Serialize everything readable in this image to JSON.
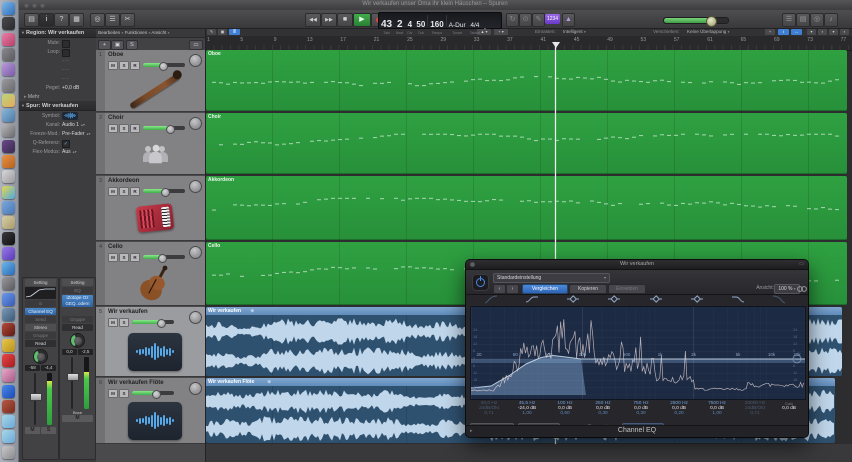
{
  "window": {
    "title": "Wir verkaufen unser Oma ihr klein Häuschen – Spuren"
  },
  "icons": {
    "library": "▤",
    "inspector": "i",
    "quick_help": "?",
    "toolbar_toggle": "▦",
    "smart_controls": "◎",
    "mixer": "☰",
    "editors": "✂",
    "rewind": "◀◀",
    "forward": "▶▶",
    "stop": "■",
    "play": "▶",
    "cycle": "↻",
    "autopunch": "⊙",
    "replace": "✎",
    "metronome": "▲",
    "list_editor": "☰",
    "note_pad": "▤",
    "loop_browser": "◎",
    "media_browser": "♪",
    "pencil_tool": "✎",
    "catch": "▣",
    "midi_in": "≣",
    "pointer_tool": "▲",
    "plus_tool": "+",
    "crosshair": "+",
    "ibeam": "I",
    "hscroll": "↔"
  },
  "transport": {
    "bar": "43",
    "beat": "2",
    "division": "4",
    "tick": "50",
    "tempo": "160",
    "key": "A-Dur",
    "timesig": "4/4",
    "labels": {
      "bar": "Takt",
      "beat": "Beat",
      "division": "Div",
      "tick": "Tick",
      "tempo": "Tempo",
      "key": "Tonart",
      "timesig": "Taktart"
    },
    "countin_badge": "1234"
  },
  "snap": {
    "einrasten_label": "Einrasten:",
    "einrasten_value": "Intelligent",
    "verschieben_label": "Verschieben:",
    "verschieben_value": "Keine Überlappung"
  },
  "menus": {
    "bearbeiten": "Bearbeiten",
    "funktionen": "Funktionen",
    "ansicht": "Ansicht"
  },
  "inspector": {
    "region_header": "Region: Wir verkaufen",
    "track_header": "Spur: Wir verkaufen",
    "region_rows": [
      {
        "label": "Mute:",
        "type": "check",
        "value": ""
      },
      {
        "label": "Loop:",
        "type": "check",
        "value": ""
      },
      {
        "label": "",
        "type": "dash",
        "value": "– –"
      },
      {
        "label": "",
        "type": "dash",
        "value": "– –"
      },
      {
        "label": "",
        "type": "dash",
        "value": "– –"
      },
      {
        "label": "Pegel:",
        "type": "text",
        "value": "+0,0 dB"
      },
      {
        "label": "",
        "type": "disclosure",
        "value": "Mehr"
      }
    ],
    "track_rows": [
      {
        "label": "Symbol:",
        "type": "icon",
        "value": ""
      },
      {
        "label": "Kanal:",
        "type": "select",
        "value": "Audio 1"
      },
      {
        "label": "Freeze-Mod.:",
        "type": "select",
        "value": "Pre-Fader"
      },
      {
        "label": "Q-Referenz:",
        "type": "checkon",
        "value": "✓"
      },
      {
        "label": "Flex-Modus:",
        "type": "select",
        "value": "Aus"
      }
    ]
  },
  "strips": {
    "left": {
      "setting": "Setting",
      "insert": "Channel EQ",
      "send": "Send",
      "output": "Stereo",
      "group": "Gruppe",
      "automation": "Read",
      "vals": [
        "-58",
        "-4,4"
      ],
      "ms": [
        "M",
        "S"
      ],
      "meter": 0.84
    },
    "right": {
      "setting": "Setting",
      "eq": "EQ",
      "insert_lines": [
        "iZotope Oz",
        "GEQ..odern"
      ],
      "group": "Gruppe",
      "automation": "Read",
      "vals": [
        "0,0",
        "-2,5"
      ],
      "name": "Bnce",
      "ms": [
        "M"
      ],
      "meter": 0.72
    }
  },
  "tracks": {
    "list": [
      {
        "num": "1",
        "name": "Oboe",
        "icon": "bassoon",
        "buttons": [
          "M",
          "S",
          "R"
        ],
        "vol": 0.45,
        "selected": false
      },
      {
        "num": "2",
        "name": "Choir",
        "icon": "choir",
        "buttons": [
          "M",
          "S",
          "R"
        ],
        "vol": 0.62,
        "selected": false
      },
      {
        "num": "3",
        "name": "Akkordeon",
        "icon": "accordion",
        "buttons": [
          "M",
          "S",
          "R"
        ],
        "vol": 0.5,
        "selected": false
      },
      {
        "num": "4",
        "name": "Cello",
        "icon": "cello",
        "buttons": [
          "M",
          "S",
          "R"
        ],
        "vol": 0.42,
        "selected": false
      },
      {
        "num": "5",
        "name": "Wir verkaufen",
        "icon": "waveform",
        "buttons": [
          "M",
          "S"
        ],
        "vol": 0.66,
        "selected": true
      },
      {
        "num": "6",
        "name": "Wir verkaufen Flöte",
        "icon": "waveform",
        "buttons": [
          "M",
          "S"
        ],
        "vol": 0.55,
        "selected": false
      }
    ]
  },
  "arrange": {
    "ruler": [
      "1",
      "5",
      "9",
      "13",
      "17",
      "21",
      "25",
      "29",
      "33",
      "37",
      "41",
      "45",
      "49",
      "53",
      "57",
      "61",
      "65",
      "69",
      "73",
      "77"
    ],
    "regions": [
      {
        "name": "Oboe",
        "type": "midi"
      },
      {
        "name": "Choir",
        "type": "midi"
      },
      {
        "name": "Akkordeon",
        "type": "midi"
      },
      {
        "name": "Cello",
        "type": "midi"
      },
      {
        "name": "Wir verkaufen",
        "type": "audio"
      },
      {
        "name": "Wir verkaufen Flöte",
        "type": "audio"
      }
    ]
  },
  "plugin": {
    "titlebar": "Wir verkaufen",
    "preset": "Standardeinstellung",
    "compare": "Vergleichen",
    "copy": "Kopieren",
    "paste": "Einsetzen",
    "view_label": "Ansicht:",
    "view_value": "100 %",
    "bands": [
      {
        "freq": "20,0 Hz",
        "gain": "24dB/Okt",
        "q": "0,71",
        "dim": true,
        "icon": "lowcut"
      },
      {
        "freq": "45,5 Hz",
        "gain": "-24,0 dB",
        "q": "1,00",
        "dim": false,
        "icon": "lowshelf"
      },
      {
        "freq": "100 Hz",
        "gain": "0,0 dB",
        "q": "0,60",
        "dim": false,
        "icon": "bell"
      },
      {
        "freq": "250 Hz",
        "gain": "0,0 dB",
        "q": "0,30",
        "dim": false,
        "icon": "bell"
      },
      {
        "freq": "750 Hz",
        "gain": "0,0 dB",
        "q": "0,30",
        "dim": false,
        "icon": "bell"
      },
      {
        "freq": "2500 Hz",
        "gain": "0,0 dB",
        "q": "0,20",
        "dim": false,
        "icon": "bell"
      },
      {
        "freq": "7500 Hz",
        "gain": "0,0 dB",
        "q": "1,00",
        "dim": false,
        "icon": "highshelf"
      },
      {
        "freq": "20000 Hz",
        "gain": "24dB/Okt",
        "q": "0,71",
        "dim": true,
        "icon": "highcut"
      }
    ],
    "gain_label": "Gain",
    "master_gain": "0,0 dB",
    "footer": {
      "analyzer": "Analyzer",
      "analyzer_mode": "Post",
      "qcouple": "Q-Couple",
      "processing_label": "Processing:",
      "processing_value": "Stereo"
    },
    "bottom_title": "Channel EQ",
    "graph": {
      "freq_labels": [
        "20",
        "50",
        "100",
        "200",
        "500",
        "1k",
        "2k",
        "5k",
        "10k",
        "20k"
      ],
      "db_labels": [
        "24",
        "18",
        "12",
        "6",
        "0",
        "6",
        "12",
        "18",
        "24"
      ]
    }
  },
  "dock": {
    "icons": [
      {
        "name": "finder",
        "c1": "#7db6e8",
        "c2": "#2f6fb8"
      },
      {
        "name": "launchpad",
        "c1": "#4a4a4e",
        "c2": "#2a2a2e"
      },
      {
        "name": "photo-booth",
        "c1": "#e87fa8",
        "c2": "#b83f68"
      },
      {
        "name": "disk-utility",
        "c1": "#8a8a8e",
        "c2": "#5a5a5e"
      },
      {
        "name": "itunes",
        "c1": "#b89ad8",
        "c2": "#7a5aa8"
      },
      {
        "name": "automator",
        "c1": "#9a9a9e",
        "c2": "#6a6a6e"
      },
      {
        "name": "photos",
        "c1": "#b8d87a",
        "c2": "#e8a85a"
      },
      {
        "name": "preview",
        "c1": "#8ab6d8",
        "c2": "#4a7aa8"
      },
      {
        "name": "chess",
        "c1": "#b8b8ba",
        "c2": "#6a6a6c"
      },
      {
        "name": "imovie",
        "c1": "#6a4a8a",
        "c2": "#3a2a4e"
      },
      {
        "name": "vlc",
        "c1": "#e8924a",
        "c2": "#b8601a"
      },
      {
        "name": "utility",
        "c1": "#d8d8da",
        "c2": "#9a9a9c"
      },
      {
        "name": "color-sync",
        "c1": "#e8d84a",
        "c2": "#4aa8e8"
      },
      {
        "name": "folder-blue",
        "c1": "#7aa8d8",
        "c2": "#4a78b8"
      },
      {
        "name": "textedit",
        "c1": "#d8cfa8",
        "c2": "#a89a6a"
      },
      {
        "name": "disc",
        "c1": "#3a3a3e",
        "c2": "#111114"
      },
      {
        "name": "final-cut",
        "c1": "#9a7ae8",
        "c2": "#5a3ab8"
      },
      {
        "name": "safari",
        "c1": "#6ab6e8",
        "c2": "#2a6ab8"
      },
      {
        "name": "font-book",
        "c1": "#9a9a9e",
        "c2": "#5a5a5e"
      },
      {
        "name": "app-store",
        "c1": "#6a9ae8",
        "c2": "#3a5ab8"
      },
      {
        "name": "tools",
        "c1": "#7a9ab8",
        "c2": "#3a5a78"
      },
      {
        "name": "console",
        "c1": "#b84a3a",
        "c2": "#5a1a14"
      },
      {
        "name": "coin",
        "c1": "#e8c84a",
        "c2": "#b8901a"
      },
      {
        "name": "no-entry",
        "c1": "#e84a4a",
        "c2": "#a81a1a"
      },
      {
        "name": "paint",
        "c1": "#e8a8c8",
        "c2": "#a85a88"
      },
      {
        "name": "internet",
        "c1": "#4a8ae8",
        "c2": "#1a4ab8"
      },
      {
        "name": "red-app",
        "c1": "#b85a4a",
        "c2": "#7a2a1a"
      },
      {
        "name": "folder-1",
        "c1": "#a8d8e8",
        "c2": "#6aa8d8"
      },
      {
        "name": "folder-2",
        "c1": "#a8d8e8",
        "c2": "#6aa8d8"
      },
      {
        "name": "trash",
        "c1": "#c8c8ca",
        "c2": "#8a8a8e"
      }
    ]
  },
  "colors": {
    "accent_blue": "#3f7fd4",
    "region_green": "#2fa141",
    "audio_blue": "#2f5170",
    "play_green": "#3fae4a",
    "record_red": "#e04438",
    "countin_purple": "#8a5ad4"
  }
}
